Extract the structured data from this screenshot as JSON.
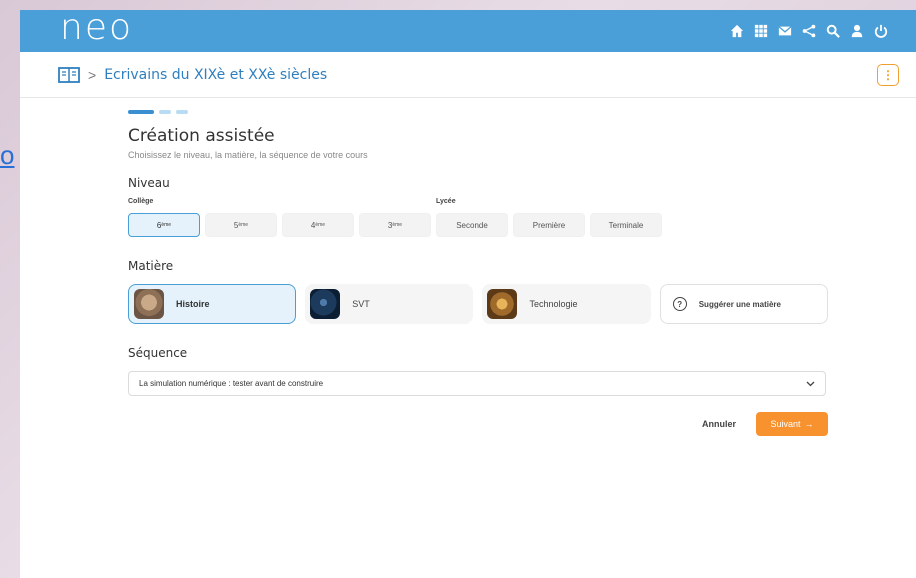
{
  "background": {
    "link_text": "o"
  },
  "app": {
    "logo": "neo"
  },
  "topbar": {
    "icons": [
      "home-icon",
      "apps-grid-icon",
      "mail-icon",
      "share-icon",
      "search-icon",
      "user-icon",
      "power-icon"
    ],
    "color": "#4a9fd8"
  },
  "breadcrumb": {
    "chevron": ">",
    "title": "Ecrivains du XIXè et XXè siècles"
  },
  "wizard": {
    "title": "Création assistée",
    "subtitle": "Choisissez le niveau, la matière, la séquence de votre cours",
    "niveau": {
      "label": "Niveau",
      "college_label": "Collège",
      "lycee_label": "Lycée",
      "college": [
        {
          "num": "6",
          "sup": "ème"
        },
        {
          "num": "5",
          "sup": "ème"
        },
        {
          "num": "4",
          "sup": "ème"
        },
        {
          "num": "3",
          "sup": "ème"
        }
      ],
      "lycee": [
        "Seconde",
        "Première",
        "Terminale"
      ]
    },
    "matiere": {
      "label": "Matière",
      "subjects": [
        "Histoire",
        "SVT",
        "Technologie"
      ],
      "suggest": "Suggérer une matière"
    },
    "sequence": {
      "label": "Séquence",
      "value": "La simulation numérique : tester avant de construire"
    },
    "actions": {
      "cancel": "Annuler",
      "next": "Suivant",
      "next_arrow": "→"
    }
  },
  "colors": {
    "accent": "#4a9fd8",
    "orange": "#f7922e",
    "link": "#2f7fbf"
  }
}
